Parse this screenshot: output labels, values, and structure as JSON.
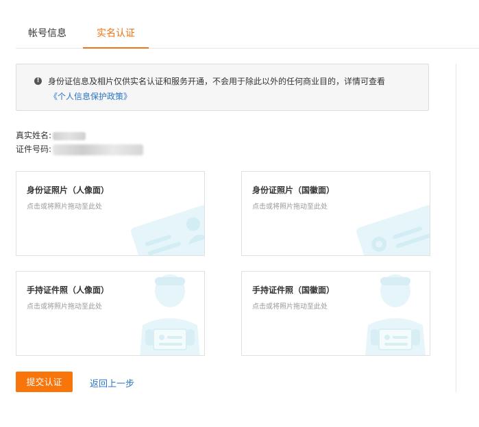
{
  "tabs": [
    {
      "label": "帐号信息"
    },
    {
      "label": "实名认证"
    }
  ],
  "notice": {
    "icon": "info-icon",
    "text": "身份证信息及相片仅供实名认证和服务开通，不会用于除此以外的任何商业目的，详情可查看",
    "link": "《个人信息保护政策》"
  },
  "info": {
    "name_label": "真实姓名:",
    "id_label": "证件号码:"
  },
  "cards": [
    {
      "title": "身份证照片（人像面）",
      "hint": "点击或将照片拖动至此处"
    },
    {
      "title": "身份证照片（国徽面）",
      "hint": "点击或将照片拖动至此处"
    },
    {
      "title": "手持证件照（人像面）",
      "hint": "点击或将照片拖动至此处"
    },
    {
      "title": "手持证件照（国徽面）",
      "hint": "点击或将照片拖动至此处"
    }
  ],
  "actions": {
    "submit": "提交认证",
    "back": "返回上一步"
  },
  "colors": {
    "accent": "#f27211",
    "link": "#2a74c9",
    "illustration": "#e6f5f9"
  }
}
